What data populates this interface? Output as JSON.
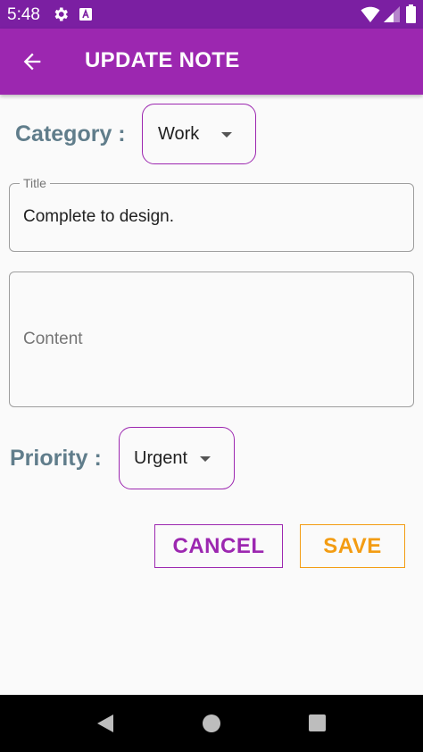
{
  "status_bar": {
    "time": "5:48",
    "icons": [
      "gear-icon",
      "a-badge-icon",
      "wifi-icon",
      "cell-signal-icon",
      "battery-icon"
    ]
  },
  "app_bar": {
    "title": "UPDATE NOTE",
    "back_icon": "arrow-left-icon"
  },
  "form": {
    "category_label": "Category :",
    "category_value": "Work",
    "title_label": "Title",
    "title_value": "Complete to design.",
    "content_placeholder": "Content",
    "content_value": "",
    "priority_label": "Priority :",
    "priority_value": "Urgent"
  },
  "buttons": {
    "cancel": "CANCEL",
    "save": "SAVE"
  },
  "nav_bar": {
    "icons": [
      "nav-back-icon",
      "nav-home-icon",
      "nav-recents-icon"
    ]
  },
  "colors": {
    "status_bar": "#7b1fa2",
    "app_bar": "#9c27b0",
    "label": "#607d8b",
    "cancel": "#9c27b0",
    "save": "#f39c12"
  }
}
